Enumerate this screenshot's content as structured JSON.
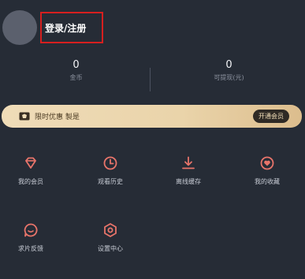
{
  "profile": {
    "login_label": "登录/注册"
  },
  "stats": {
    "coins_value": "0",
    "coins_label": "金币",
    "withdrawable_value": "0",
    "withdrawable_label": "可提现(元)"
  },
  "vip_banner": {
    "text": "限时优惠 製是",
    "button_label": "开通会员"
  },
  "menu": [
    {
      "label": "我的会员",
      "icon": "diamond-icon"
    },
    {
      "label": "观看历史",
      "icon": "clock-icon"
    },
    {
      "label": "离线缓存",
      "icon": "download-icon"
    },
    {
      "label": "我的收藏",
      "icon": "heart-icon"
    },
    {
      "label": "求片反馈",
      "icon": "feedback-icon"
    },
    {
      "label": "设置中心",
      "icon": "settings-icon"
    }
  ],
  "colors": {
    "background": "#262c36",
    "accent_icon": "#e8746a",
    "vip_gold": "#ead4aa",
    "highlight_border": "#d61f1f"
  }
}
